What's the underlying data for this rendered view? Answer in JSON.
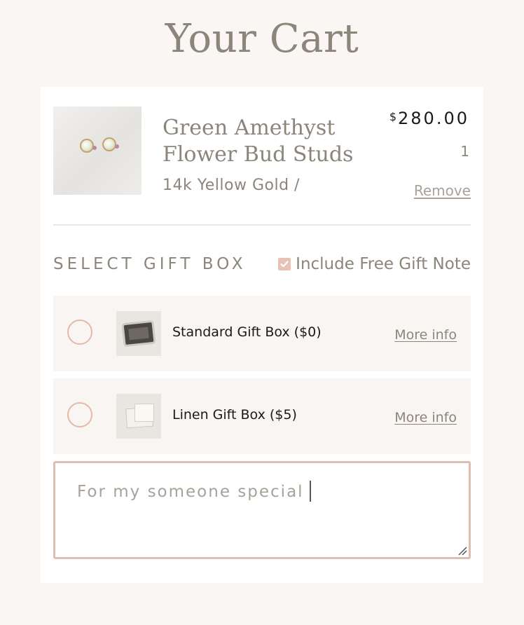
{
  "page": {
    "title": "Your Cart"
  },
  "cart_item": {
    "name": "Green Amethyst Flower Bud Studs",
    "variant": "14k Yellow Gold /",
    "currency_symbol": "$",
    "price": "280.00",
    "quantity": "1",
    "remove_label": "Remove",
    "image_icon": "earring-product-photo"
  },
  "gift": {
    "heading": "SELECT GIFT BOX",
    "note_toggle": {
      "label": "Include Free Gift Note",
      "checked": true
    },
    "options": [
      {
        "label": "Standard Gift Box ($0)",
        "more_info": "More info",
        "selected": false,
        "thumb_icon": "dark-gift-box-photo"
      },
      {
        "label": "Linen Gift Box ($5)",
        "more_info": "More info",
        "selected": false,
        "thumb_icon": "linen-gift-box-photo"
      }
    ],
    "note_value": "For my someone special"
  },
  "colors": {
    "background": "#f9f6f3",
    "card": "#ffffff",
    "text_muted": "#8c857b",
    "text_dark": "#1a1a1a",
    "accent_blush": "#e0bdb1",
    "option_bg": "#f9f5f2"
  }
}
